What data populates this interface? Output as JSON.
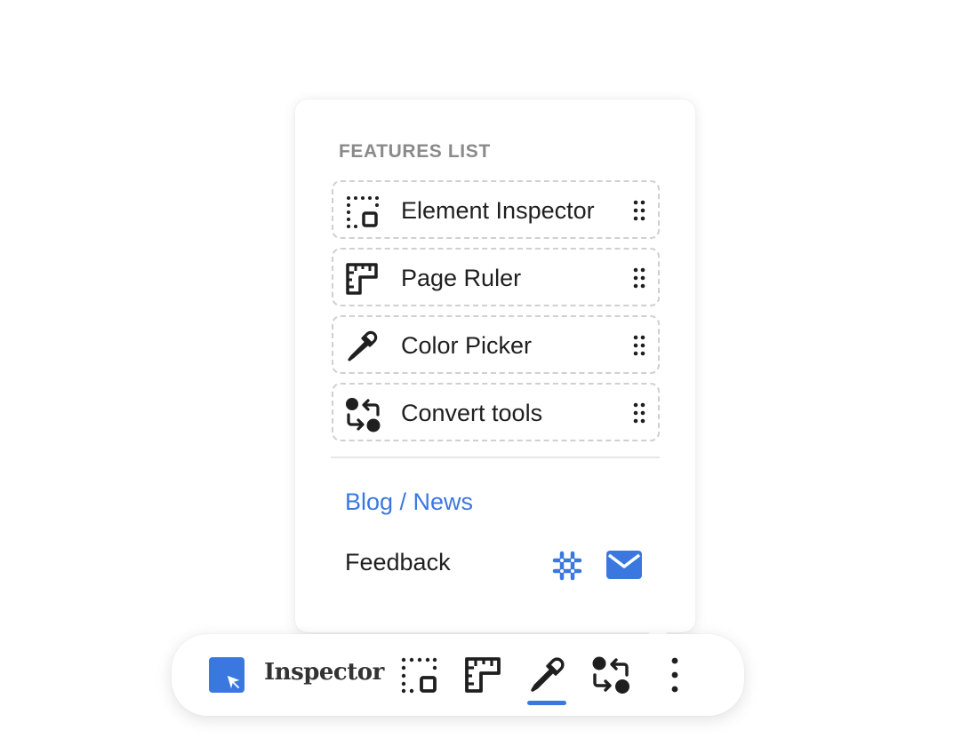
{
  "popup": {
    "title": "FEATURES LIST",
    "features": [
      {
        "label": "Element Inspector",
        "icon": "element-inspector-icon"
      },
      {
        "label": "Page Ruler",
        "icon": "ruler-icon"
      },
      {
        "label": "Color Picker",
        "icon": "eyedropper-icon"
      },
      {
        "label": "Convert tools",
        "icon": "convert-icon"
      }
    ],
    "blog_link": "Blog / News",
    "feedback_label": "Feedback",
    "feedback_icons": [
      "slack-icon",
      "mail-icon"
    ]
  },
  "toolbar": {
    "brand_name": "Inspector",
    "buttons": [
      "element-inspector-icon",
      "ruler-icon",
      "eyedropper-icon",
      "convert-icon",
      "more-vertical-icon"
    ],
    "active": "eyedropper-icon"
  },
  "colors": {
    "accent": "#3a78e0",
    "text": "#1f1f1f",
    "muted": "#8a8a8a",
    "dashed_border": "#d0d0d0"
  }
}
